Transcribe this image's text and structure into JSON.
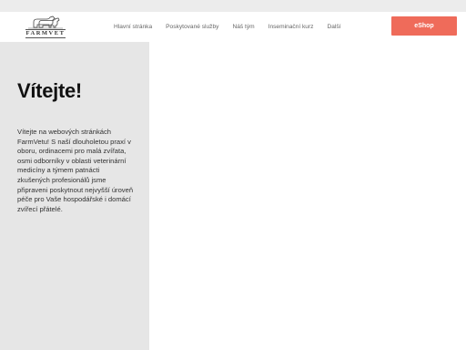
{
  "header": {
    "logo_text": "FARMVET",
    "nav": [
      {
        "label": "Hlavní stránka"
      },
      {
        "label": "Poskytované služby"
      },
      {
        "label": "Náš tým"
      },
      {
        "label": "Inseminační kurz"
      },
      {
        "label": "Další"
      }
    ],
    "eshop_label": "eShop"
  },
  "hero": {
    "title": "Vítejte!",
    "text": "Vítejte na webových stránkách FarmVetu! S naší dlouholetou praxí v oboru, ordinacemi pro malá zvířata, osmi odborníky v oblasti veterinární medicíny a týmem patnácti zkušených profesionálů jsme připraveni poskytnout nejvyšší úroveň péče pro Vaše hospodářské i domácí zvířecí přátelé."
  },
  "colors": {
    "accent": "#ef6b5a",
    "panel": "#e6e6e6",
    "top_strip": "#ececec"
  }
}
